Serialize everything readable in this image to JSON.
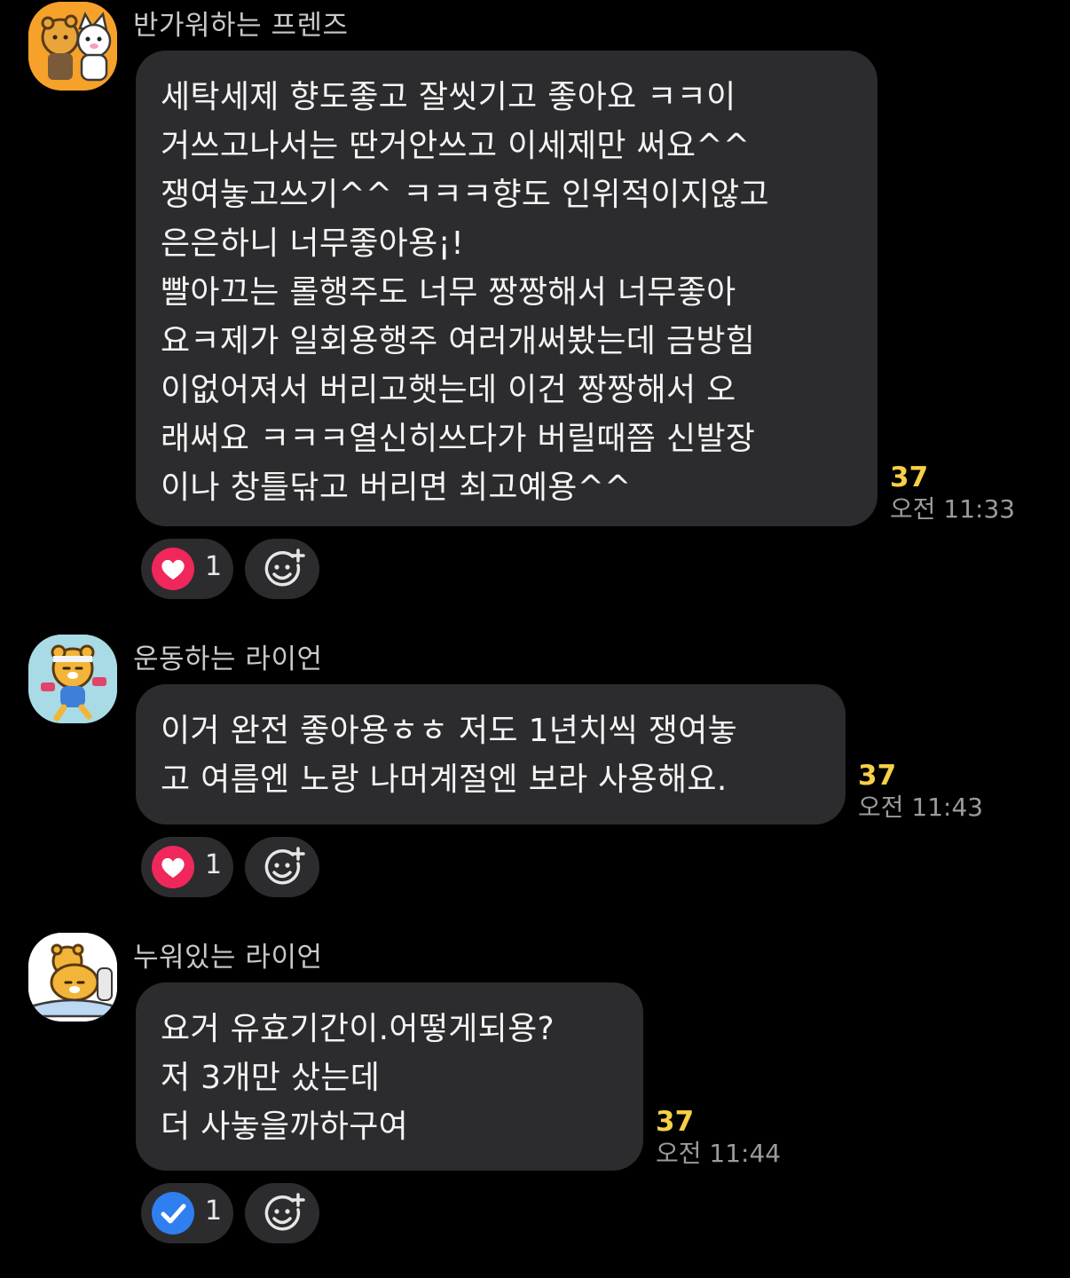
{
  "messages": [
    {
      "sender": "반가워하는 프렌즈",
      "avatar_icon": "friends-avatar-icon",
      "avatar_bg": "#f6a12a",
      "text": "세탁세제 향도좋고 잘씻기고 좋아요 ㅋㅋ이\n거쓰고나서는 딴거안쓰고 이세제만 써요^^\n쟁여놓고쓰기^^ ㅋㅋㅋ향도 인위적이지않고\n은은하니 너무좋아용¡!\n빨아끄는 롤행주도 너무 짱짱해서 너무좋아\n요ㅋ제가 일회용행주 여러개써봤는데 금방힘\n이없어져서 버리고햇는데 이건 짱짱해서 오\n래써요 ㅋㅋㅋ열신히쓰다가 버릴때쯤 신발장\n이나 창틀닦고 버리면 최고예용^^",
      "unread": "37",
      "time": "오전 11:33",
      "reaction_icon": "heart-icon",
      "reaction_color": "#f0275a",
      "reaction_count": "1"
    },
    {
      "sender": "운동하는 라이언",
      "avatar_icon": "exercising-ryan-avatar-icon",
      "avatar_bg": "#a9dbe6",
      "text": "이거 완전 좋아용ㅎㅎ 저도 1년치씩 쟁여놓\n고 여름엔 노랑 나머계절엔 보라 사용해요.",
      "unread": "37",
      "time": "오전 11:43",
      "reaction_icon": "heart-icon",
      "reaction_color": "#f0275a",
      "reaction_count": "1"
    },
    {
      "sender": "누워있는 라이언",
      "avatar_icon": "lying-ryan-avatar-icon",
      "avatar_bg": "#ffffff",
      "text": "요거 유효기간이.어떻게되용?\n저 3개만 샀는데\n더 사놓을까하구여",
      "unread": "37",
      "time": "오전 11:44",
      "reaction_icon": "check-icon",
      "reaction_color": "#2f7ff0",
      "reaction_count": "1"
    }
  ],
  "add_reaction_icon": "add-emoji-icon"
}
